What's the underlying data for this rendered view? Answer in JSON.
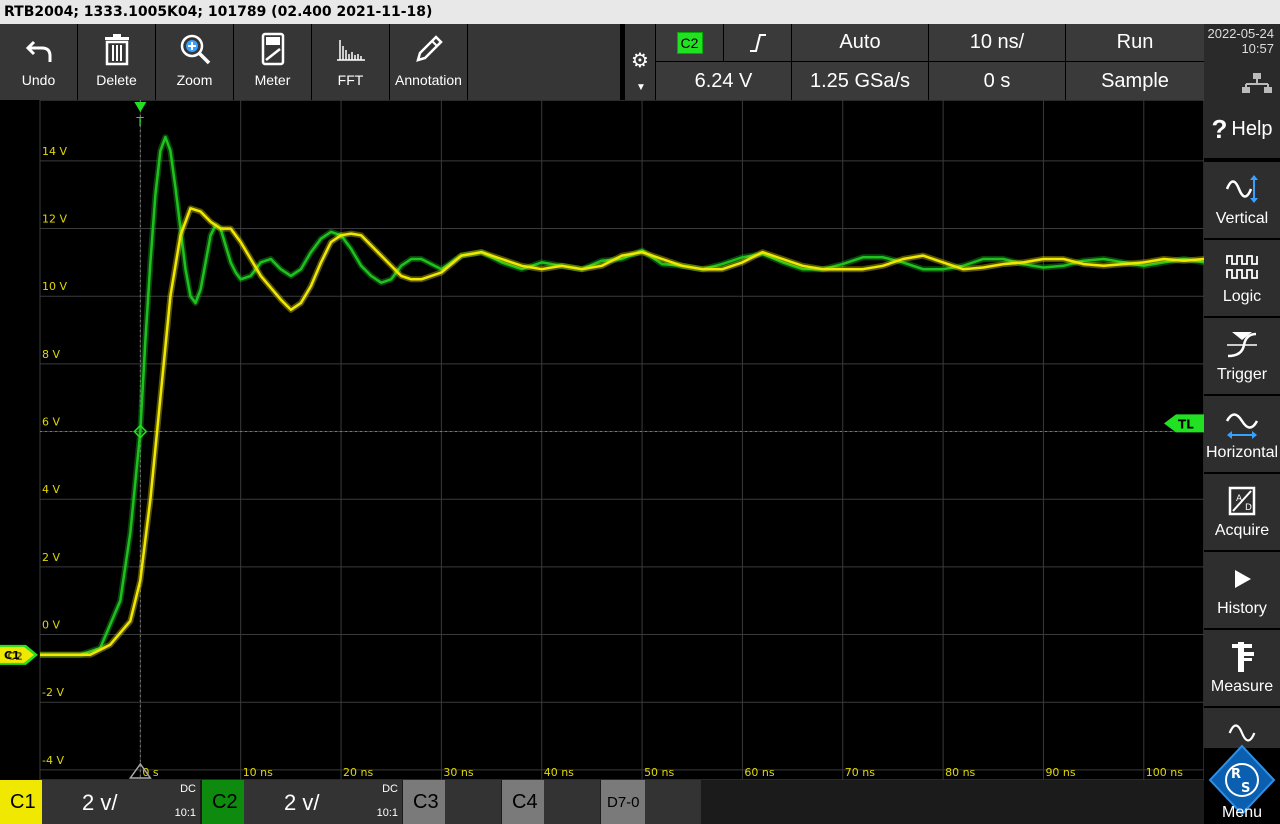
{
  "title_bar": "RTB2004; 1333.1005K04; 101789 (02.400 2021-11-18)",
  "toolbar": [
    {
      "label": "Undo",
      "icon": "undo-icon"
    },
    {
      "label": "Delete",
      "icon": "trash-icon"
    },
    {
      "label": "Zoom",
      "icon": "zoom-in-icon"
    },
    {
      "label": "Meter",
      "icon": "meter-icon"
    },
    {
      "label": "FFT",
      "icon": "fft-icon"
    },
    {
      "label": "Annotation",
      "icon": "pencil-icon"
    }
  ],
  "trigger": {
    "source": "C2",
    "slope": "rising-edge",
    "level": "6.24 V",
    "mode": "Auto",
    "sample_rate": "1.25 GSa/s",
    "timebase": "10 ns/",
    "position": "0 s",
    "run_state": "Run",
    "acquisition": "Sample"
  },
  "clock": {
    "date": "2022-05-24",
    "time": "10:57"
  },
  "right_menu": [
    {
      "label": "Help",
      "icon": "help-icon"
    },
    {
      "label": "Vertical",
      "icon": "vertical-icon"
    },
    {
      "label": "Logic",
      "icon": "logic-icon"
    },
    {
      "label": "Trigger",
      "icon": "trigger-icon"
    },
    {
      "label": "Horizontal",
      "icon": "horizontal-icon"
    },
    {
      "label": "Acquire",
      "icon": "acquire-icon"
    },
    {
      "label": "History",
      "icon": "play-icon"
    },
    {
      "label": "Measure",
      "icon": "caliper-icon"
    },
    {
      "label": "Menu",
      "icon": "rs-logo-icon"
    }
  ],
  "channels": [
    {
      "name": "C1",
      "scale": "2 v/",
      "coupling": "DC",
      "probe": "10:1",
      "color": "#f0e800",
      "active": true
    },
    {
      "name": "C2",
      "scale": "2 v/",
      "coupling": "DC",
      "probe": "10:1",
      "color": "#1ec21e",
      "active": true
    },
    {
      "name": "C3",
      "active": false
    },
    {
      "name": "C4",
      "active": false
    },
    {
      "name": "D7-0",
      "active": false
    }
  ],
  "markers": {
    "trigger_level": "TL",
    "ground_c1": "C1",
    "ground_c2": "C2"
  },
  "chart_data": {
    "type": "line",
    "grid": true,
    "xlim": [
      -10,
      106
    ],
    "ylim": [
      -4.3,
      15.8
    ],
    "x_ticks": [
      "0 s",
      "10 ns",
      "20 ns",
      "30 ns",
      "40 ns",
      "50 ns",
      "60 ns",
      "70 ns",
      "80 ns",
      "90 ns",
      "100 ns"
    ],
    "x_tick_values": [
      0,
      10,
      20,
      30,
      40,
      50,
      60,
      70,
      80,
      90,
      100
    ],
    "y_ticks": [
      "14 V",
      "12 V",
      "10 V",
      "8 V",
      "6 V",
      "4 V",
      "2 V",
      "0 V",
      "-2 V",
      "-4 V"
    ],
    "y_tick_values": [
      14,
      12,
      10,
      8,
      6,
      4,
      2,
      0,
      -2,
      -4
    ],
    "series": [
      {
        "name": "C1",
        "color": "#f0e800",
        "x": [
          -10,
          -5,
          -3,
          -1,
          0,
          1,
          2,
          3,
          4,
          5,
          6,
          7,
          8,
          9,
          10,
          12,
          14,
          15,
          16,
          17,
          18,
          19,
          20,
          21,
          22,
          24,
          26,
          27,
          28,
          30,
          32,
          34,
          36,
          38,
          40,
          42,
          44,
          46,
          48,
          50,
          52,
          54,
          56,
          58,
          60,
          62,
          64,
          66,
          68,
          70,
          72,
          74,
          76,
          78,
          80,
          82,
          84,
          86,
          88,
          90,
          92,
          94,
          96,
          98,
          100,
          102,
          104,
          106
        ],
        "y": [
          -0.6,
          -0.6,
          -0.3,
          0.4,
          1.6,
          4.0,
          7.0,
          10.0,
          11.8,
          12.6,
          12.5,
          12.2,
          12.0,
          12.0,
          11.6,
          10.6,
          9.9,
          9.6,
          9.8,
          10.3,
          11.0,
          11.6,
          11.8,
          11.85,
          11.8,
          11.2,
          10.6,
          10.5,
          10.5,
          10.7,
          11.2,
          11.3,
          11.1,
          10.9,
          10.8,
          10.9,
          10.8,
          10.9,
          11.2,
          11.3,
          11.1,
          10.9,
          10.8,
          10.8,
          11.0,
          11.3,
          11.1,
          10.9,
          10.8,
          10.8,
          10.8,
          10.9,
          11.1,
          11.2,
          11.0,
          10.8,
          10.85,
          10.95,
          11.0,
          11.1,
          11.1,
          10.95,
          10.9,
          10.95,
          11.0,
          11.1,
          11.05,
          11.1
        ]
      },
      {
        "name": "C2",
        "color": "#1ec21e",
        "x": [
          -10,
          -6,
          -4,
          -2,
          -1,
          0,
          0.5,
          1,
          1.5,
          2,
          2.5,
          3,
          3.5,
          4,
          4.5,
          5,
          5.5,
          6,
          6.5,
          7,
          7.5,
          8,
          8.5,
          9,
          9.5,
          10,
          11,
          12,
          13,
          14,
          15,
          16,
          17,
          18,
          19,
          20,
          21,
          22,
          23,
          24,
          25,
          26,
          27,
          28,
          30,
          32,
          34,
          36,
          38,
          40,
          42,
          44,
          46,
          48,
          50,
          52,
          54,
          56,
          58,
          60,
          62,
          64,
          66,
          68,
          70,
          72,
          74,
          76,
          78,
          80,
          82,
          84,
          86,
          88,
          90,
          92,
          94,
          96,
          98,
          100,
          102,
          104,
          106
        ],
        "y": [
          -0.6,
          -0.6,
          -0.4,
          1.0,
          3.0,
          6.0,
          8.7,
          11.0,
          13.0,
          14.3,
          14.7,
          14.3,
          13.2,
          12.0,
          10.8,
          10.0,
          9.8,
          10.2,
          11.0,
          11.8,
          12.1,
          12.0,
          11.5,
          11.0,
          10.7,
          10.5,
          10.6,
          11.0,
          11.1,
          10.8,
          10.6,
          10.8,
          11.3,
          11.7,
          11.9,
          11.8,
          11.4,
          10.9,
          10.6,
          10.4,
          10.5,
          10.9,
          11.1,
          11.1,
          10.8,
          11.2,
          11.3,
          11.0,
          10.8,
          11.0,
          10.9,
          10.8,
          11.05,
          11.1,
          11.35,
          10.95,
          10.9,
          10.8,
          10.95,
          11.15,
          11.25,
          11.0,
          10.8,
          10.8,
          10.95,
          11.15,
          11.15,
          11.0,
          10.8,
          10.8,
          10.9,
          11.1,
          11.1,
          10.95,
          10.85,
          10.9,
          11.05,
          11.1,
          11.0,
          10.9,
          11.0,
          11.1,
          11.0
        ]
      }
    ]
  }
}
